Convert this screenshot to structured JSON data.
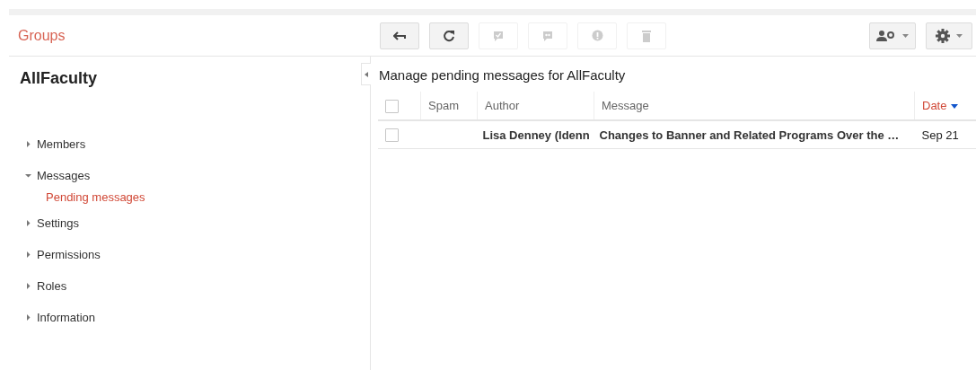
{
  "header": {
    "title": "Groups"
  },
  "toolbar": {
    "buttons": [
      {
        "kind": "back",
        "disabled": false
      },
      {
        "kind": "refresh",
        "disabled": false
      },
      {
        "kind": "approve",
        "disabled": true
      },
      {
        "kind": "reply",
        "disabled": true
      },
      {
        "kind": "spam",
        "disabled": true
      },
      {
        "kind": "delete",
        "disabled": true
      }
    ],
    "menus": [
      {
        "kind": "members"
      },
      {
        "kind": "settings"
      }
    ]
  },
  "sidebar": {
    "group": "AllFaculty",
    "items": [
      {
        "label": "Members",
        "expanded": false
      },
      {
        "label": "Messages",
        "expanded": true,
        "children": [
          {
            "label": "Pending messages",
            "selected": true
          }
        ]
      },
      {
        "label": "Settings",
        "expanded": false
      },
      {
        "label": "Permissions",
        "expanded": false
      },
      {
        "label": "Roles",
        "expanded": false
      },
      {
        "label": "Information",
        "expanded": false
      }
    ]
  },
  "main": {
    "title": "Manage pending messages for AllFaculty",
    "columns": [
      {
        "label": "Spam",
        "sorted": false
      },
      {
        "label": "Author",
        "sorted": false
      },
      {
        "label": "Message",
        "sorted": false
      },
      {
        "label": "Date",
        "sorted": true
      }
    ],
    "header_checked": false,
    "rows": [
      {
        "checked": false,
        "author": "Lisa Denney (Idenn",
        "message": "Changes to Banner and Related Programs Over the …",
        "date": "Sep 21"
      }
    ]
  }
}
